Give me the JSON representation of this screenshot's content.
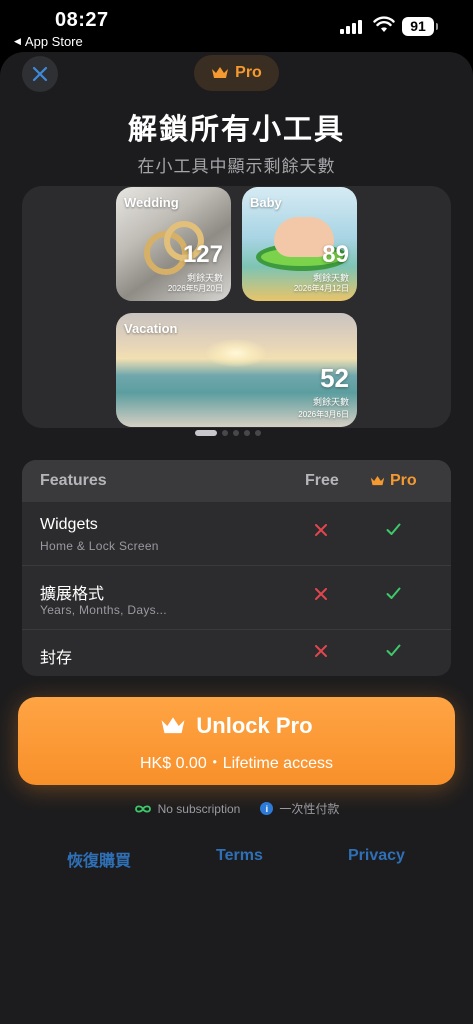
{
  "status_bar": {
    "time": "08:27",
    "back_label": "App Store",
    "battery": "91"
  },
  "header": {
    "pro_badge": "Pro",
    "title": "解鎖所有小工具",
    "subtitle": "在小工具中顯示剩餘天數"
  },
  "widgets": [
    {
      "label": "Wedding",
      "count": "127",
      "unit": "剩餘天數",
      "date": "2026年5月20日"
    },
    {
      "label": "Baby",
      "count": "89",
      "unit": "剩餘天數",
      "date": "2026年4月12日"
    },
    {
      "label": "Vacation",
      "count": "52",
      "unit": "剩餘天數",
      "date": "2026年3月6日"
    }
  ],
  "carousel": {
    "pages": 5,
    "active": 1
  },
  "features": {
    "header": {
      "features": "Features",
      "free": "Free",
      "pro": "Pro"
    },
    "rows": [
      {
        "title": "Widgets",
        "subtitle": "Home & Lock Screen",
        "free": false,
        "pro": true
      },
      {
        "title": "擴展格式",
        "subtitle": "Years, Months, Days...",
        "free": false,
        "pro": true
      },
      {
        "title": "封存",
        "subtitle": "",
        "free": false,
        "pro": true
      }
    ]
  },
  "unlock": {
    "title": "Unlock Pro",
    "subtitle": "HK$ 0.00・Lifetime access"
  },
  "assurances": {
    "no_subscription": "No subscription",
    "one_time": "一次性付款"
  },
  "links": {
    "restore": "恢復購買",
    "terms": "Terms",
    "privacy": "Privacy"
  },
  "colors": {
    "accent": "#f59a30",
    "check": "#3dc96a",
    "cross": "#e0474c",
    "link": "#2f6fb5",
    "sheet": "#1c1c1e"
  },
  "icons": {
    "close": "close-icon",
    "crown": "crown-icon",
    "check": "check-icon",
    "cross": "cross-icon",
    "infinity": "infinity-icon",
    "info": "info-icon"
  }
}
